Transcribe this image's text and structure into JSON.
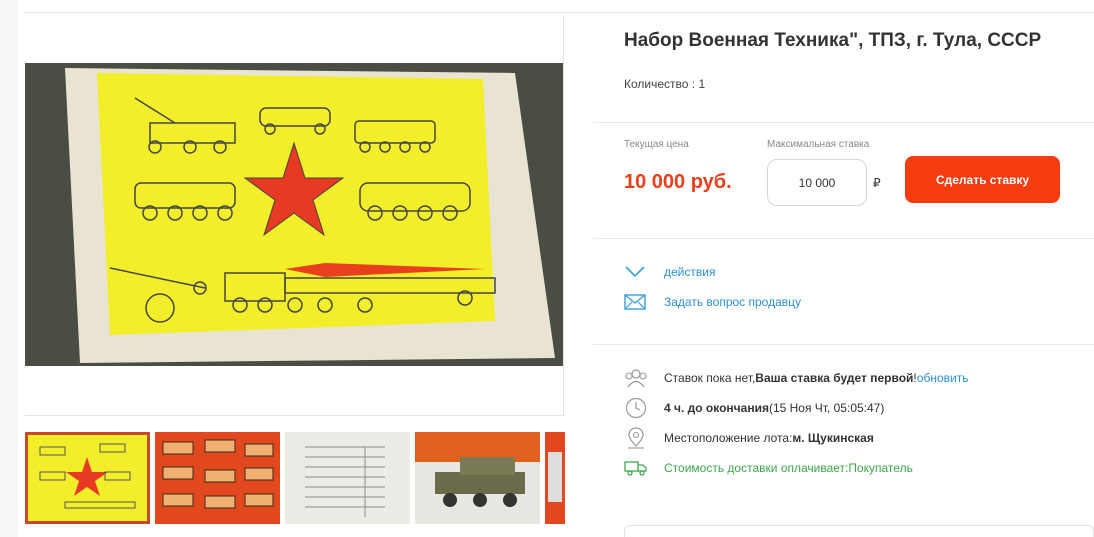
{
  "lot": {
    "title": "Набор Военная Техника\", ТПЗ, г. Тула, СССР",
    "quantity": "Количество : 1"
  },
  "bid": {
    "current_price_label": "Текущая цена",
    "current_price": "10 000 руб.",
    "max_bid_label": "Максимальная ставка",
    "max_bid_value": "10 000",
    "currency_symbol": "₽",
    "submit_label": "Сделать ставку"
  },
  "actions": {
    "actions_label": "действия",
    "ask_seller_label": "Задать вопрос продавцу"
  },
  "info": {
    "bids_prefix": "Ставок пока нет, ",
    "bids_emphasis": "Ваша ставка будет первой",
    "bids_excl": "! ",
    "refresh_label": "обновить",
    "time_left": "4 ч. до окончания",
    "end_date": " (15 Ноя Чт, 05:05:47)",
    "location_label": "Местоположение лота: ",
    "location_value": "м. Щукинская",
    "shipping_label": "Стоимость доставки оплачивает: ",
    "shipping_payer": "Покупатель"
  },
  "colors": {
    "accent": "#f43c10",
    "price": "#e8401c",
    "link": "#2a8fd8",
    "green": "#3aa84a"
  },
  "icons": [
    "chevron-down-icon",
    "envelope-icon",
    "users-icon",
    "clock-icon",
    "map-pin-icon",
    "delivery-truck-icon"
  ]
}
